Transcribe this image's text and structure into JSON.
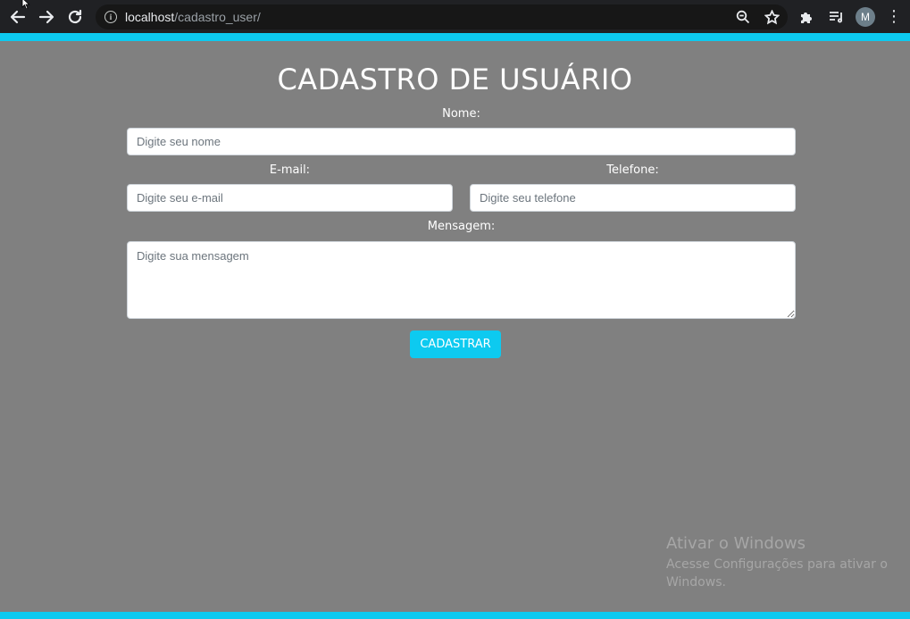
{
  "browser": {
    "url_host": "localhost",
    "url_path": "/cadastro_user/",
    "avatar_initial": "M"
  },
  "form": {
    "title": "CADASTRO DE USUÁRIO",
    "name_label": "Nome:",
    "name_placeholder": "Digite seu nome",
    "email_label": "E-mail:",
    "email_placeholder": "Digite seu e-mail",
    "phone_label": "Telefone:",
    "phone_placeholder": "Digite seu telefone",
    "message_label": "Mensagem:",
    "message_placeholder": "Digite sua mensagem",
    "submit_label": "CADASTRAR"
  },
  "watermark": {
    "title": "Ativar o Windows",
    "subtitle": "Acesse Configurações para ativar o Windows."
  },
  "colors": {
    "accent": "#0dcaf0",
    "background": "#808080",
    "chrome": "#202124"
  }
}
